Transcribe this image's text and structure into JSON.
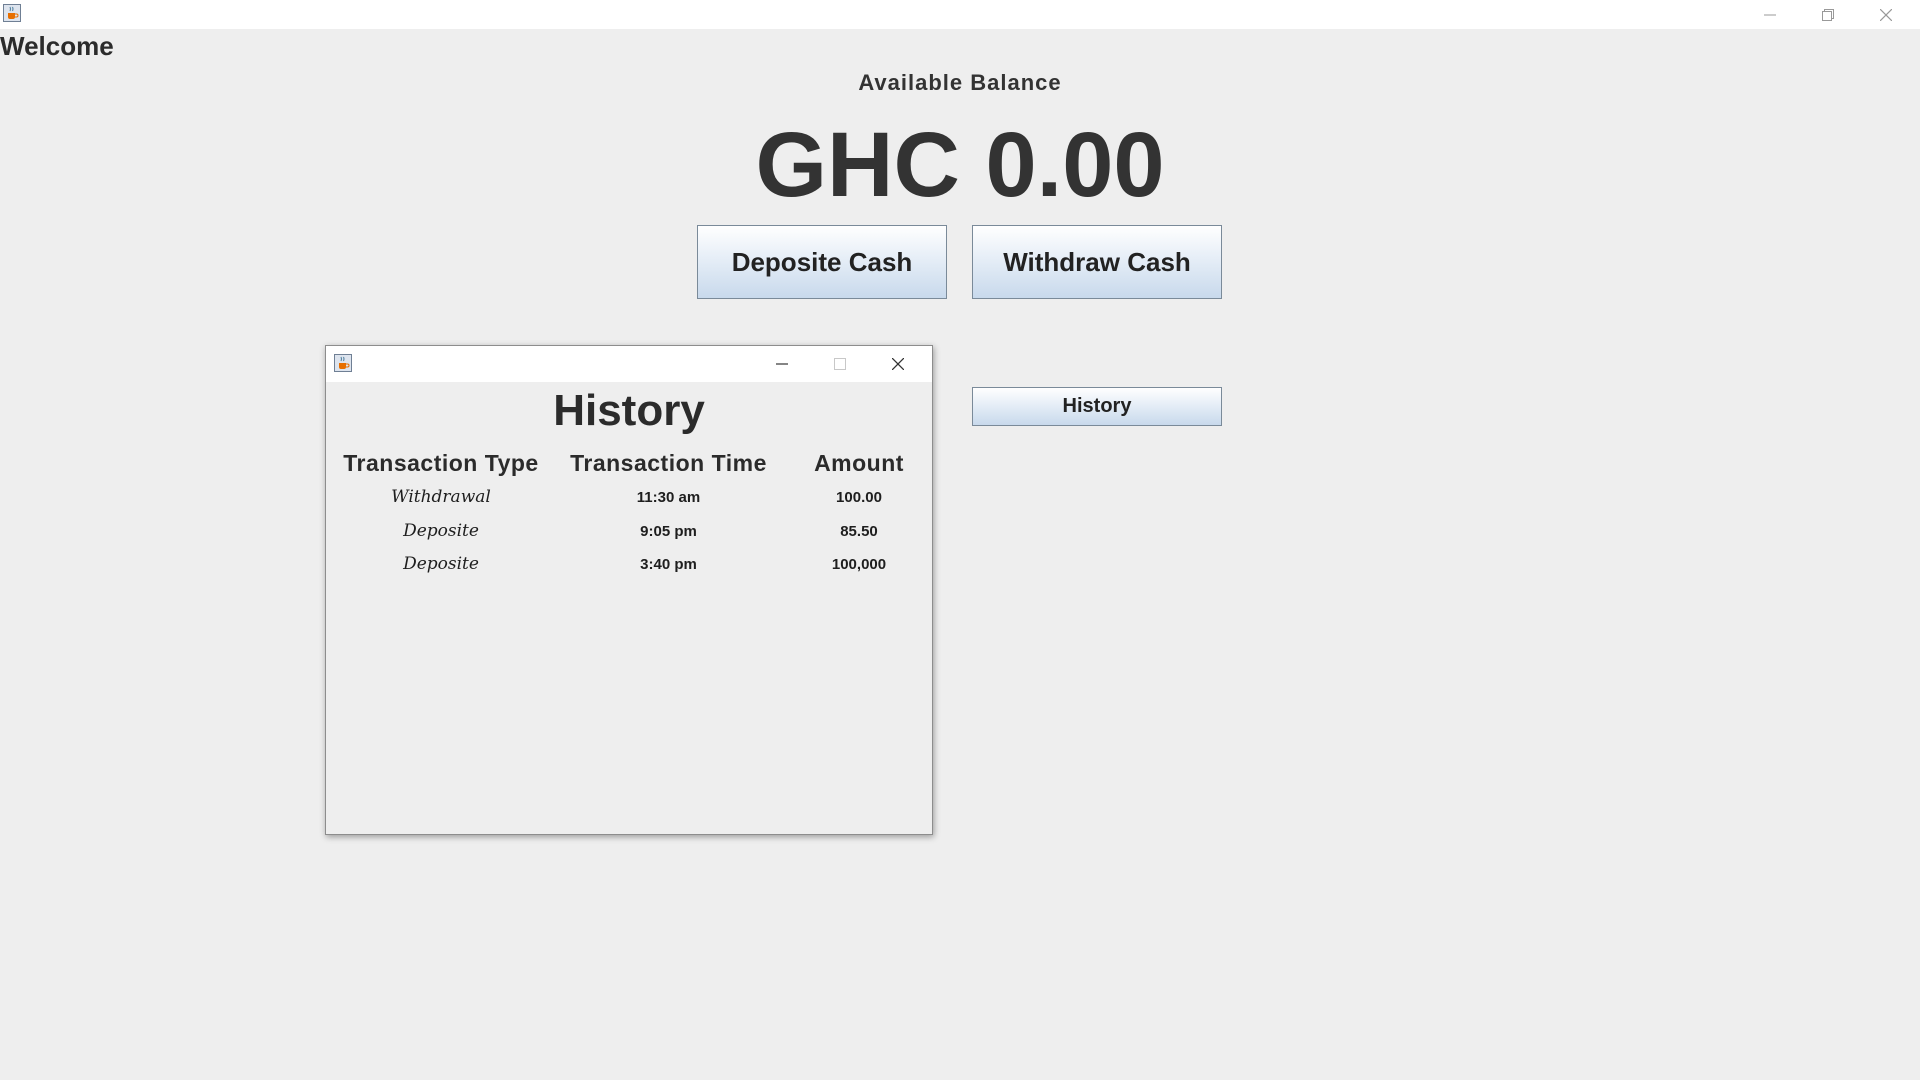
{
  "main_window": {
    "icon": "java-cup-icon",
    "controls": [
      "minimize-icon",
      "restore-icon",
      "close-icon"
    ]
  },
  "welcome_text": "Welcome",
  "balance": {
    "label": "Available Balance",
    "amount": "GHC 0.00"
  },
  "buttons": {
    "deposit": "Deposite Cash",
    "withdraw": "Withdraw Cash",
    "history": "History"
  },
  "history_window": {
    "icon": "java-cup-icon",
    "controls": [
      "minimize-icon",
      "maximize-icon",
      "close-icon"
    ],
    "title": "History",
    "columns": [
      "Transaction Type",
      "Transaction Time",
      "Amount"
    ],
    "rows": [
      {
        "type": "Withdrawal",
        "time": "11:30 am",
        "amount": "100.00"
      },
      {
        "type": "Deposite",
        "time": "9:05 pm",
        "amount": "85.50"
      },
      {
        "type": "Deposite",
        "time": "3:40 pm",
        "amount": "100,000"
      }
    ]
  }
}
